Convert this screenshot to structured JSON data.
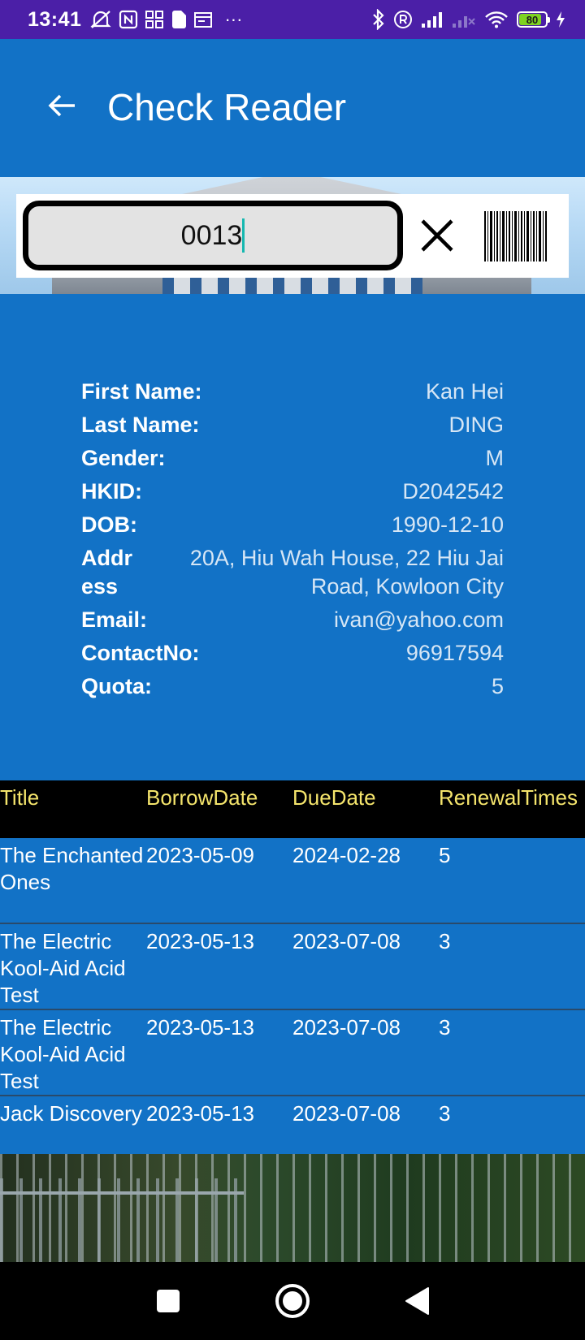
{
  "status_bar": {
    "time": "13:41",
    "left_icons": [
      "mute-notification-icon",
      "nfc-icon",
      "apps-icon",
      "file-icon",
      "calendar-icon",
      "more-icon"
    ],
    "more_dots": "···",
    "battery_level": "80",
    "right_icons": [
      "bluetooth-icon",
      "roaming-icon",
      "signal-icon",
      "signal-2-icon",
      "wifi-icon",
      "battery-icon",
      "charging-icon"
    ]
  },
  "app_bar": {
    "title": "Check Reader",
    "back_icon": "arrow-left-icon"
  },
  "search": {
    "value": "0013",
    "clear_icon": "close-icon",
    "scan_icon": "barcode-icon"
  },
  "reader": {
    "first_name_label": "First Name:",
    "first_name": "Kan Hei",
    "last_name_label": "Last Name:",
    "last_name": "DING",
    "gender_label": "Gender:",
    "gender": "M",
    "hkid_label": "HKID:",
    "hkid": "D2042542",
    "dob_label": "DOB:",
    "dob": "1990-12-10",
    "address_label": "Address",
    "address": "20A, Hiu Wah House, 22 Hiu Jai Road, Kowloon City",
    "email_label": "Email:",
    "email": "ivan@yahoo.com",
    "contact_label": "ContactNo:",
    "contact": "96917594",
    "quota_label": "Quota:",
    "quota": "5"
  },
  "loans": {
    "headers": [
      "Title",
      "BorrowDate",
      "DueDate",
      "RenewalTimes"
    ],
    "rows": [
      {
        "title": "The Enchanted Ones",
        "borrow": "2023-05-09",
        "due": "2024-02-28",
        "renewals": "5"
      },
      {
        "title": "The Electric Kool-Aid Acid Test",
        "borrow": "2023-05-13",
        "due": "2023-07-08",
        "renewals": "3"
      },
      {
        "title": "The Electric Kool-Aid Acid Test",
        "borrow": "2023-05-13",
        "due": "2023-07-08",
        "renewals": "3"
      },
      {
        "title": "Jack Discovery",
        "borrow": "2023-05-13",
        "due": "2023-07-08",
        "renewals": "3"
      }
    ]
  },
  "nav_bar": {
    "recents_icon": "square-icon",
    "home_icon": "circle-icon",
    "back_icon": "triangle-back-icon"
  },
  "colors": {
    "status_bar": "#4b1fa7",
    "app_bg": "#1272c6",
    "table_header_bg": "#000000",
    "table_header_text": "#f5e56c",
    "caret": "#16b8b0"
  }
}
